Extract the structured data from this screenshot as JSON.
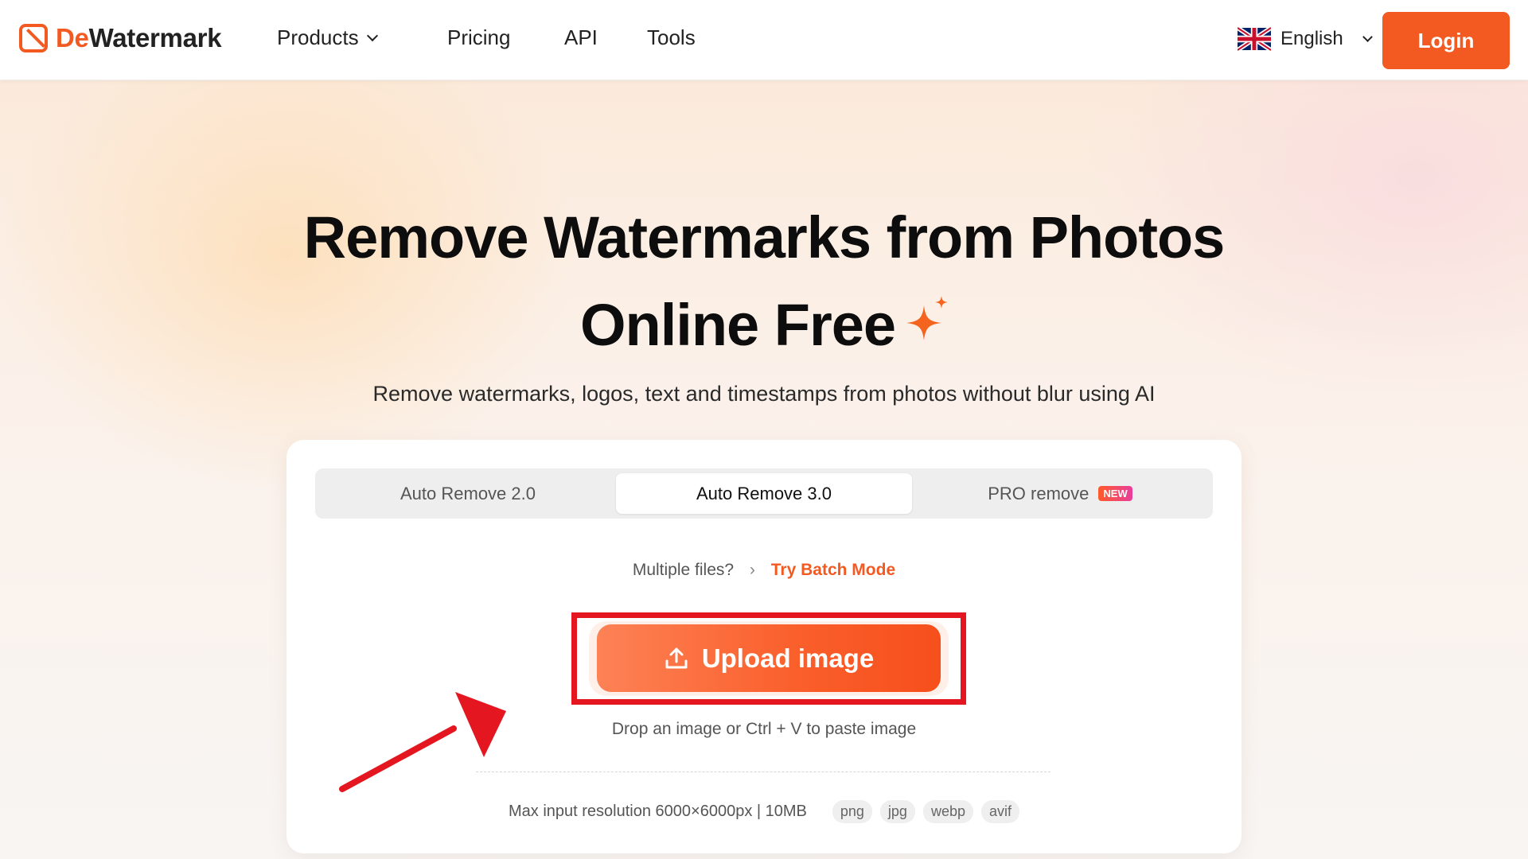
{
  "header": {
    "logo_prefix": "De",
    "logo_suffix": "Watermark",
    "nav": [
      {
        "label": "Products",
        "dropdown": true
      },
      {
        "label": "Pricing"
      },
      {
        "label": "API"
      },
      {
        "label": "Tools"
      }
    ],
    "language": "English",
    "login_label": "Login"
  },
  "hero": {
    "title_line1": "Remove Watermarks from Photos",
    "title_line2": "Online Free",
    "subtitle": "Remove watermarks, logos, text and timestamps from photos without blur using AI"
  },
  "tool": {
    "tabs": [
      {
        "label": "Auto Remove 2.0",
        "active": false
      },
      {
        "label": "Auto Remove 3.0",
        "active": true
      },
      {
        "label": "PRO remove",
        "active": false,
        "badge": "NEW"
      }
    ],
    "batch_question": "Multiple files?",
    "batch_link": "Try Batch Mode",
    "upload_label": "Upload image",
    "drop_hint": "Drop an image or Ctrl + V to paste image",
    "limits": "Max input resolution 6000×6000px | 10MB",
    "formats": [
      "png",
      "jpg",
      "webp",
      "avif"
    ]
  },
  "colors": {
    "brand": "#f25a21",
    "annotation": "#e4161f"
  },
  "icons": {
    "logo": "dewatermark-logo-icon",
    "language_flag": "uk-flag-icon",
    "sparkle": "sparkle-icon",
    "upload": "upload-icon",
    "chevron": "chevron-down-icon"
  }
}
